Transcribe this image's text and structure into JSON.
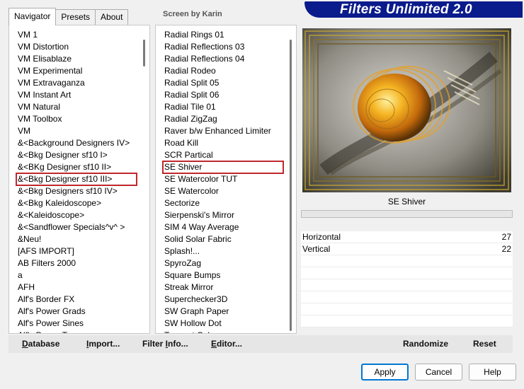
{
  "tabs": [
    {
      "label": "Navigator",
      "active": true
    },
    {
      "label": "Presets",
      "active": false
    },
    {
      "label": "About",
      "active": false
    }
  ],
  "credit": "Screen by Karin",
  "banner": {
    "title": "Filters Unlimited 2.0",
    "color": "#0a1b8c"
  },
  "categories": {
    "items": [
      "VM 1",
      "VM Distortion",
      "VM Elisablaze",
      "VM Experimental",
      "VM Extravaganza",
      "VM Instant Art",
      "VM Natural",
      "VM Toolbox",
      "VM",
      "&<Background Designers IV>",
      "&<Bkg Designer sf10 I>",
      "&<BKg Designer sf10 II>",
      "&<Bkg Designer sf10 III>",
      "&<Bkg Designers sf10 IV>",
      "&<Bkg Kaleidoscope>",
      "&<Kaleidoscope>",
      "&<Sandflower Specials^v^ >",
      "&Neu!",
      "[AFS IMPORT]",
      "AB Filters 2000",
      "a",
      "AFH",
      "Alf's Border FX",
      "Alf's Power Grads",
      "Alf's Power Sines",
      "Alf's Power Toys"
    ],
    "selected": "&<Bkg Designer sf10 III>",
    "scroll_fraction": 0.05
  },
  "filters": {
    "items": [
      "Radial  Rings 01",
      "Radial Reflections 03",
      "Radial Reflections 04",
      "Radial Rodeo",
      "Radial Split 05",
      "Radial Split 06",
      "Radial Tile 01",
      "Radial ZigZag",
      "Raver b/w Enhanced Limiter",
      "Road Kill",
      "SCR  Partical",
      "SE Shiver",
      "SE Watercolor TUT",
      "SE Watercolor",
      "Sectorize",
      "Sierpenski's Mirror",
      "SIM 4 Way Average",
      "Solid Solar Fabric",
      "Splash!...",
      "SpyroZag",
      "Square Bumps",
      "Streak Mirror",
      "Superchecker3D",
      "SW Graph Paper",
      "SW Hollow Dot",
      "Tangent Cube"
    ],
    "selected": "SE Shiver",
    "scroll_fraction": 0.04
  },
  "current_filter": "SE Shiver",
  "params": [
    {
      "name": "Horizontal",
      "value": "27"
    },
    {
      "name": "Vertical",
      "value": "22"
    }
  ],
  "bottom_bar": {
    "database": {
      "u": "D",
      "rest": "atabase"
    },
    "import": {
      "u": "I",
      "rest": "mport..."
    },
    "filter_info": {
      "pre": "Filter ",
      "u": "I",
      "rest": "nfo..."
    },
    "editor": {
      "u": "E",
      "rest": "ditor..."
    },
    "randomize": "Randomize",
    "reset": "Reset"
  },
  "buttons": {
    "apply": "Apply",
    "cancel": "Cancel",
    "help": "Help"
  },
  "colors": {
    "selection_outline": "#c0282d",
    "default_button_border": "#0078d4"
  }
}
